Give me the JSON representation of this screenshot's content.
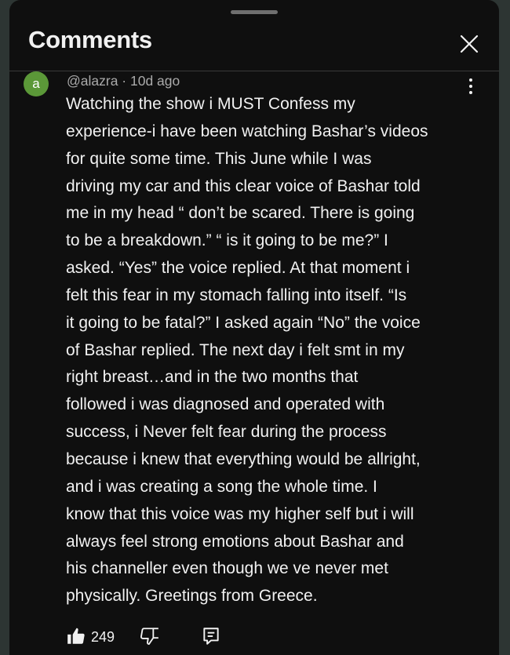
{
  "panel": {
    "title": "Comments",
    "close_icon": "close-icon"
  },
  "comment": {
    "avatar_letter": "a",
    "avatar_color": "#5b9838",
    "author": "@alazra",
    "separator": "·",
    "time": "10d ago",
    "meta_text": "@alazra · 10d ago",
    "text": "Watching the show i MUST Confess my\nexperience-i have been watching Bashar’s videos\nfor quite some time. This June while I was\ndriving my car and this clear voice of Bashar told\nme in my head “ don’t be scared. There is going\nto be a breakdown.” “ is it going to be me?” I\nasked. “Yes” the voice replied. At that moment i\nfelt this fear in my stomach falling into itself. “Is\nit going to be fatal?” I asked again “No” the voice\nof Bashar replied.   The next day i felt smt in my\nright breast…and in the two months that\nfollowed i was diagnosed and operated with\nsuccess, i Never felt fear during the process\nbecause i knew that everything would be allright,\nand i was creating a song the whole time.    I\nknow that this voice was my higher self but i will\nalways feel strong emotions about Bashar and\nhis channeller even though we ve never met\nphysically. Greetings from Greece.",
    "like_count": "249",
    "icons": {
      "more": "more-vert-icon",
      "like": "thumbs-up-icon",
      "dislike": "thumbs-down-icon",
      "reply": "reply-comment-icon"
    }
  },
  "colors": {
    "background": "#0f0f0f",
    "text_primary": "#f1f1f1",
    "text_secondary": "#aaaaaa"
  }
}
